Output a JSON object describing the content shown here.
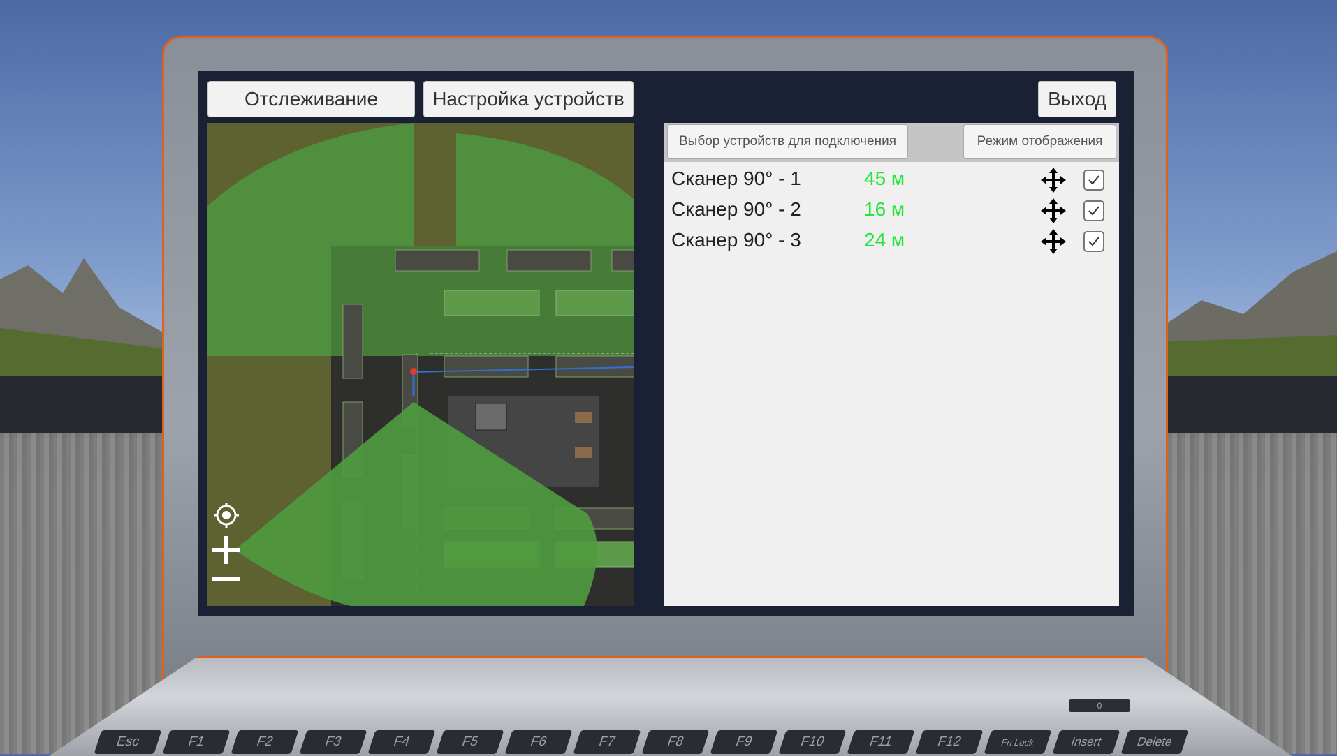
{
  "toolbar": {
    "tracking_label": "Отслеживание",
    "device_setup_label": "Настройка устройств",
    "exit_label": "Выход"
  },
  "panel": {
    "tab_select_devices": "Выбор устройств для подключения",
    "tab_display_mode": "Режим отображения",
    "devices": [
      {
        "name": "Сканер 90° - 1",
        "distance": "45 м",
        "checked": true
      },
      {
        "name": "Сканер 90° - 2",
        "distance": "16 м",
        "checked": true
      },
      {
        "name": "Сканер 90° - 3",
        "distance": "24 м",
        "checked": true
      }
    ]
  },
  "map": {
    "controls": [
      "locate-icon",
      "zoom-in-icon",
      "zoom-out-icon"
    ],
    "colors": {
      "coverage": "#4f9a3f",
      "terrain": "#5e6130",
      "road": "#2b2b2b",
      "route": "#2f6fd8",
      "marker": "#e53b2a"
    }
  },
  "keyboard": {
    "keys": [
      "Esc",
      "F1",
      "F2",
      "F3",
      "F4",
      "F5",
      "F6",
      "F7",
      "F8",
      "F9",
      "F10",
      "F11",
      "F12",
      "Fn Lock",
      "Insert",
      "Delete"
    ],
    "power_key": "0"
  },
  "colors": {
    "accent": "#e0611f",
    "distance_text": "#22e638",
    "screen_bg": "#1b2134"
  }
}
